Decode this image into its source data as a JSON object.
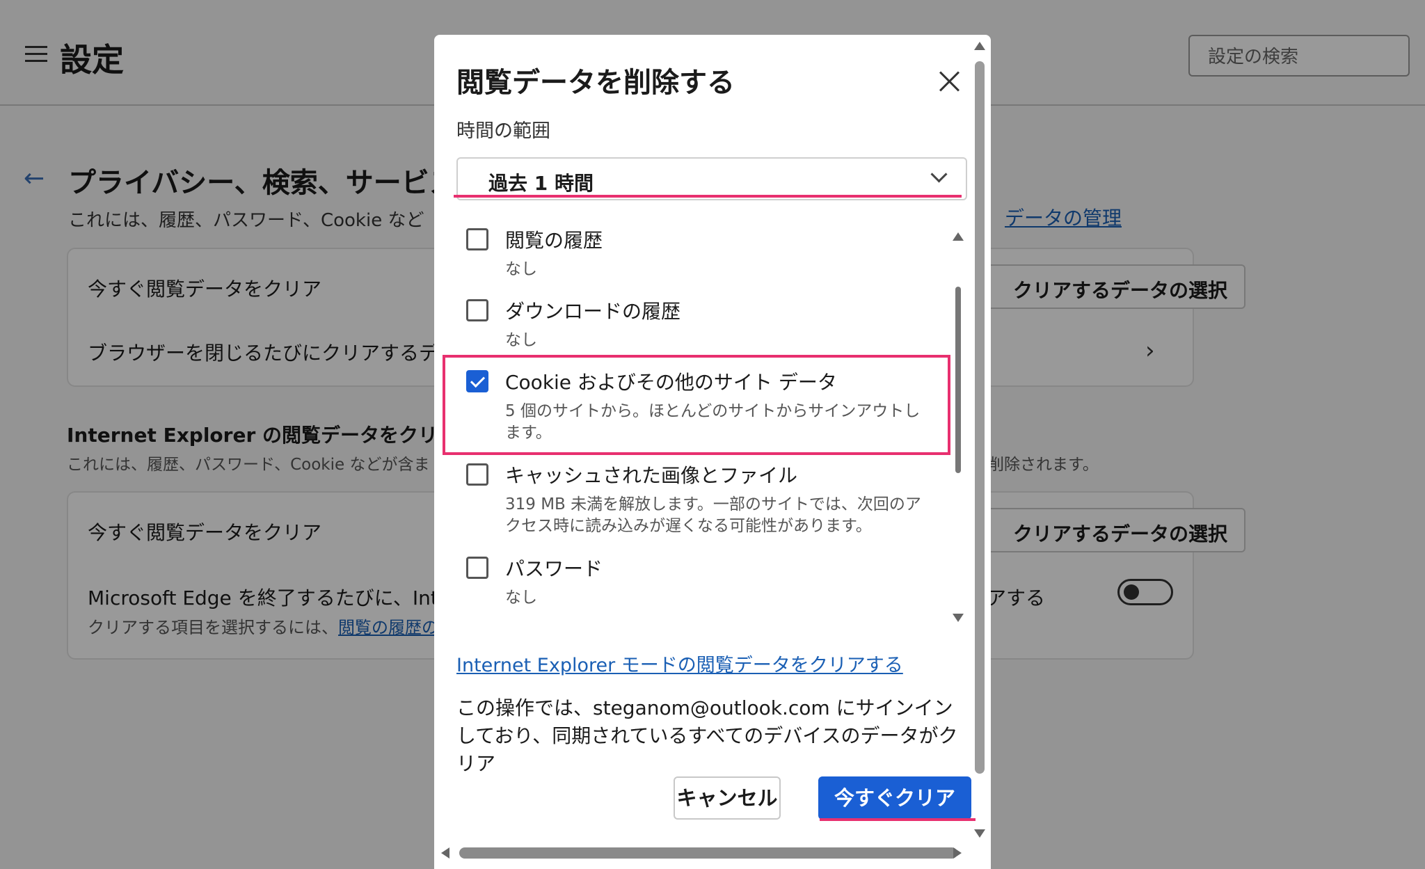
{
  "settings": {
    "title": "設定",
    "search_placeholder": "設定の検索",
    "section_title": "プライバシー、検索、サービス",
    "section_desc": "これには、履歴、パスワード、Cookie など",
    "manage_link": "データの管理",
    "card1": {
      "row1": "今すぐ閲覧データをクリア",
      "row1_button": "クリアするデータの選択",
      "row2": "ブラウザーを閉じるたびにクリアするデ"
    },
    "ie_section": {
      "title": "Internet Explorer の閲覧データをクリアす",
      "desc": "これには、履歴、パスワード、Cookie などが含ま",
      "desc_tail": "削除されます。"
    },
    "card2": {
      "row1": "今すぐ閲覧データをクリア",
      "row1_button": "クリアするデータの選択",
      "row2": "Microsoft Edge を終了するたびに、Inter",
      "row2_tail": "アする",
      "row2_sub": "クリアする項目を選択するには、",
      "row2_sub_link": "閲覧の履歴の"
    }
  },
  "dialog": {
    "title": "閲覧データを削除する",
    "time_range_label": "時間の範囲",
    "time_range_value": "過去 1 時間",
    "options": [
      {
        "label": "閲覧の履歴",
        "desc": "なし",
        "checked": false
      },
      {
        "label": "ダウンロードの履歴",
        "desc": "なし",
        "checked": false
      },
      {
        "label": "Cookie およびその他のサイト データ",
        "desc": "5 個のサイトから。ほとんどのサイトからサインアウトします。",
        "checked": true
      },
      {
        "label": "キャッシュされた画像とファイル",
        "desc": "319 MB 未満を解放します。一部のサイトでは、次回のアクセス時に読み込みが遅くなる可能性があります。",
        "checked": false
      },
      {
        "label": "パスワード",
        "desc": "なし",
        "checked": false
      }
    ],
    "ie_link": "Internet Explorer モードの閲覧データをクリアする",
    "sync_note": "この操作では、steganom@outlook.com にサインインしており、同期されているすべてのデバイスのデータがクリア",
    "cancel_label": "キャンセル",
    "clear_label": "今すぐクリア"
  },
  "colors": {
    "accent": "#1a5fd4",
    "highlight": "#e8306f",
    "link": "#1a5fb4"
  },
  "icons": [
    "hamburger-icon",
    "back-arrow-icon",
    "chevron-right-icon",
    "close-icon",
    "chevron-down-icon",
    "check-icon"
  ]
}
